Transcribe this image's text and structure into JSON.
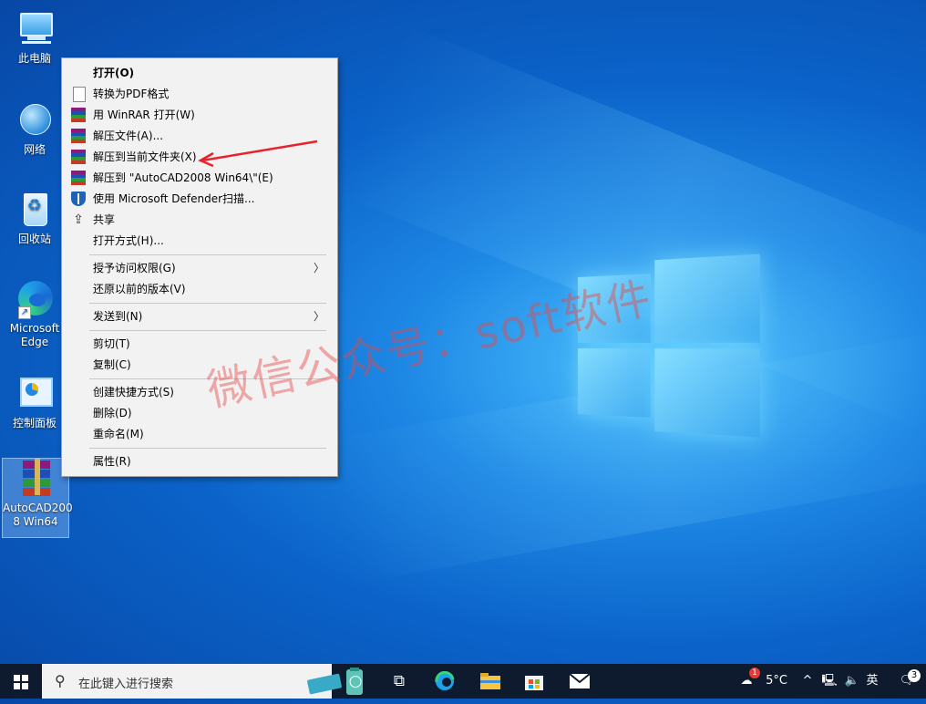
{
  "desktop": {
    "icons": [
      {
        "label_line1": "此电脑",
        "label_line2": ""
      },
      {
        "label_line1": "网络",
        "label_line2": ""
      },
      {
        "label_line1": "回收站",
        "label_line2": ""
      },
      {
        "label_line1": "Microsoft",
        "label_line2": "Edge"
      },
      {
        "label_line1": "控制面板",
        "label_line2": ""
      },
      {
        "label_line1": "AutoCAD200",
        "label_line2": "8 Win64"
      }
    ]
  },
  "context_menu": {
    "items": [
      {
        "label": "打开(O)",
        "icon": "none"
      },
      {
        "label": "转换为PDF格式",
        "icon": "document-icon"
      },
      {
        "label": "用 WinRAR 打开(W)",
        "icon": "winrar-icon"
      },
      {
        "label": "解压文件(A)...",
        "icon": "winrar-icon"
      },
      {
        "label": "解压到当前文件夹(X)",
        "icon": "winrar-icon"
      },
      {
        "label": "解压到 \"AutoCAD2008 Win64\\\"(E)",
        "icon": "winrar-icon"
      },
      {
        "label": "使用 Microsoft Defender扫描...",
        "icon": "defender-shield-icon"
      },
      {
        "label": "共享",
        "icon": "share-icon"
      },
      {
        "label": "打开方式(H)...",
        "icon": "none"
      },
      {
        "label": "授予访问权限(G)",
        "icon": "none",
        "submenu": true
      },
      {
        "label": "还原以前的版本(V)",
        "icon": "none"
      },
      {
        "label": "发送到(N)",
        "icon": "none",
        "submenu": true
      },
      {
        "label": "剪切(T)",
        "icon": "none"
      },
      {
        "label": "复制(C)",
        "icon": "none"
      },
      {
        "label": "创建快捷方式(S)",
        "icon": "none"
      },
      {
        "label": "删除(D)",
        "icon": "none"
      },
      {
        "label": "重命名(M)",
        "icon": "none"
      },
      {
        "label": "属性(R)",
        "icon": "none"
      }
    ],
    "submenu_arrow": "〉",
    "annotation_arrow_color": "#e8222a"
  },
  "watermark": "微信公众号：soft软件",
  "taskbar": {
    "search_placeholder": "在此键入进行搜索",
    "tray": {
      "weather_badge": "1",
      "temperature": "5°C",
      "caret": "^",
      "ime": "英",
      "notification_count": "3"
    }
  },
  "colors": {
    "desktop_blue": "#0b63c9",
    "taskbar": "#0e1b2e",
    "menu_bg": "#f2f2f2"
  }
}
